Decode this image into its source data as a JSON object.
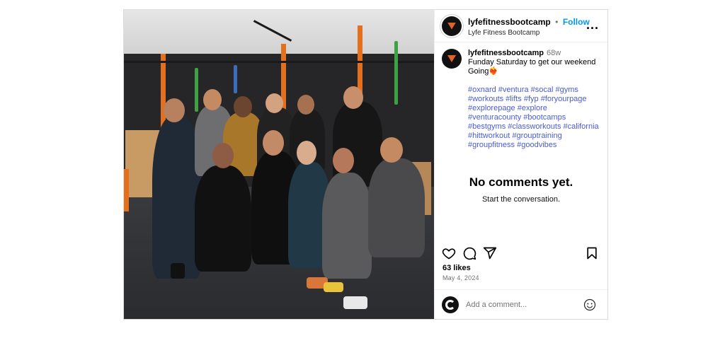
{
  "header": {
    "username": "lyfefitnessbootcamp",
    "separator": "•",
    "follow_label": "Follow",
    "display_name": "Lyfe Fitness Bootcamp",
    "more_label": "..."
  },
  "caption": {
    "username": "lyfefitnessbootcamp",
    "age": "68w",
    "text": "Funday Saturday to get our weekend Going❤️‍🔥",
    "hashtags": "#oxnard #ventura #socal #gyms #workouts #lifts #fyp #foryourpage #explorepage #explore #venturacounty #bootcamps #bestgyms #classworkouts #california #hittworkout #grouptraining #groupfitness #goodvibes"
  },
  "comments": {
    "empty_title": "No comments yet.",
    "empty_subtitle": "Start the conversation."
  },
  "stats": {
    "likes": "63 likes",
    "date": "May 4, 2024"
  },
  "add_comment": {
    "placeholder": "Add a comment..."
  },
  "icons": [
    "heart-icon",
    "comment-icon",
    "share-icon",
    "bookmark-icon",
    "emoji-icon",
    "more-icon"
  ],
  "colors": {
    "follow": "#0095f6",
    "hashtag": "#4a5bd6",
    "brand_orange": "#e2632a",
    "border": "#dbdbdb"
  }
}
